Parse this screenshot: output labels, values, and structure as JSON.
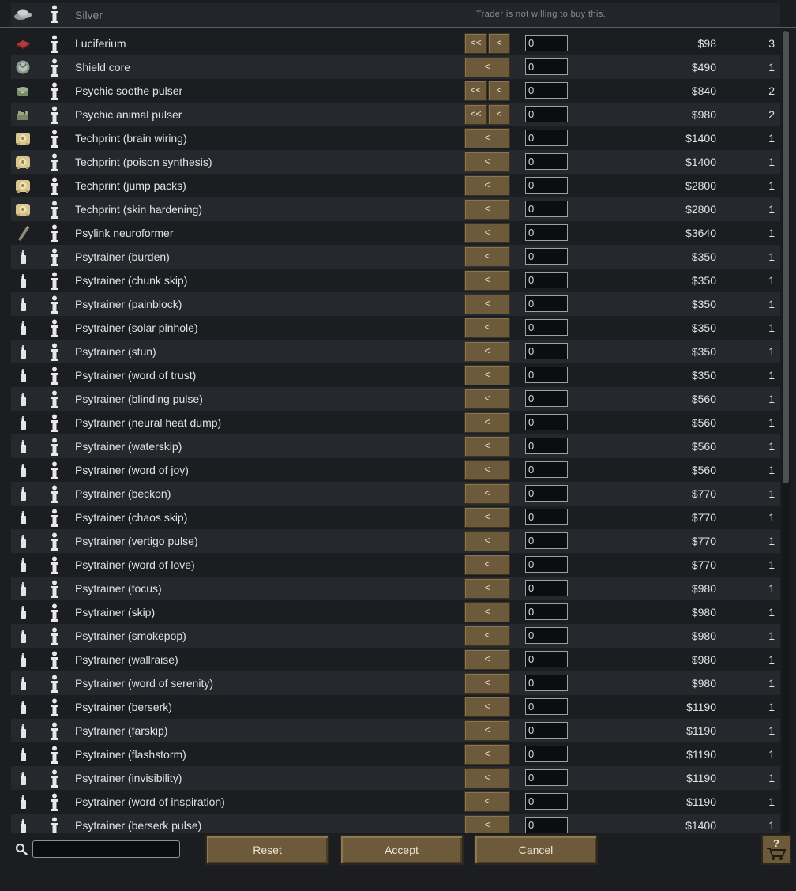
{
  "header": {
    "currency_name": "Silver",
    "note": "Trader is not willing to buy this.",
    "currency_icon": "silver-coins-icon"
  },
  "rows": [
    {
      "name": "Luciferium",
      "price": "$98",
      "count": "3",
      "qty": "0",
      "buttons": [
        "<<",
        "<"
      ],
      "icon": "luciferium-icon"
    },
    {
      "name": "Shield core",
      "price": "$490",
      "count": "1",
      "qty": "0",
      "buttons": [
        "<"
      ],
      "icon": "shield-core-icon"
    },
    {
      "name": "Psychic soothe pulser",
      "price": "$840",
      "count": "2",
      "qty": "0",
      "buttons": [
        "<<",
        "<"
      ],
      "icon": "pulser-icon"
    },
    {
      "name": "Psychic animal pulser",
      "price": "$980",
      "count": "2",
      "qty": "0",
      "buttons": [
        "<<",
        "<"
      ],
      "icon": "animal-pulser-icon"
    },
    {
      "name": "Techprint (brain wiring)",
      "price": "$1400",
      "count": "1",
      "qty": "0",
      "buttons": [
        "<"
      ],
      "icon": "techprint-icon"
    },
    {
      "name": "Techprint (poison synthesis)",
      "price": "$1400",
      "count": "1",
      "qty": "0",
      "buttons": [
        "<"
      ],
      "icon": "techprint-icon"
    },
    {
      "name": "Techprint (jump packs)",
      "price": "$2800",
      "count": "1",
      "qty": "0",
      "buttons": [
        "<"
      ],
      "icon": "techprint-icon"
    },
    {
      "name": "Techprint (skin hardening)",
      "price": "$2800",
      "count": "1",
      "qty": "0",
      "buttons": [
        "<"
      ],
      "icon": "techprint-icon"
    },
    {
      "name": "Psylink neuroformer",
      "price": "$3640",
      "count": "1",
      "qty": "0",
      "buttons": [
        "<"
      ],
      "icon": "neuroformer-icon"
    },
    {
      "name": "Psytrainer (burden)",
      "price": "$350",
      "count": "1",
      "qty": "0",
      "buttons": [
        "<"
      ],
      "icon": "psytrainer-icon"
    },
    {
      "name": "Psytrainer (chunk skip)",
      "price": "$350",
      "count": "1",
      "qty": "0",
      "buttons": [
        "<"
      ],
      "icon": "psytrainer-icon"
    },
    {
      "name": "Psytrainer (painblock)",
      "price": "$350",
      "count": "1",
      "qty": "0",
      "buttons": [
        "<"
      ],
      "icon": "psytrainer-icon"
    },
    {
      "name": "Psytrainer (solar pinhole)",
      "price": "$350",
      "count": "1",
      "qty": "0",
      "buttons": [
        "<"
      ],
      "icon": "psytrainer-icon"
    },
    {
      "name": "Psytrainer (stun)",
      "price": "$350",
      "count": "1",
      "qty": "0",
      "buttons": [
        "<"
      ],
      "icon": "psytrainer-icon"
    },
    {
      "name": "Psytrainer (word of trust)",
      "price": "$350",
      "count": "1",
      "qty": "0",
      "buttons": [
        "<"
      ],
      "icon": "psytrainer-icon"
    },
    {
      "name": "Psytrainer (blinding pulse)",
      "price": "$560",
      "count": "1",
      "qty": "0",
      "buttons": [
        "<"
      ],
      "icon": "psytrainer-icon"
    },
    {
      "name": "Psytrainer (neural heat dump)",
      "price": "$560",
      "count": "1",
      "qty": "0",
      "buttons": [
        "<"
      ],
      "icon": "psytrainer-icon"
    },
    {
      "name": "Psytrainer (waterskip)",
      "price": "$560",
      "count": "1",
      "qty": "0",
      "buttons": [
        "<"
      ],
      "icon": "psytrainer-icon"
    },
    {
      "name": "Psytrainer (word of joy)",
      "price": "$560",
      "count": "1",
      "qty": "0",
      "buttons": [
        "<"
      ],
      "icon": "psytrainer-icon"
    },
    {
      "name": "Psytrainer (beckon)",
      "price": "$770",
      "count": "1",
      "qty": "0",
      "buttons": [
        "<"
      ],
      "icon": "psytrainer-icon"
    },
    {
      "name": "Psytrainer (chaos skip)",
      "price": "$770",
      "count": "1",
      "qty": "0",
      "buttons": [
        "<"
      ],
      "icon": "psytrainer-icon"
    },
    {
      "name": "Psytrainer (vertigo pulse)",
      "price": "$770",
      "count": "1",
      "qty": "0",
      "buttons": [
        "<"
      ],
      "icon": "psytrainer-icon"
    },
    {
      "name": "Psytrainer (word of love)",
      "price": "$770",
      "count": "1",
      "qty": "0",
      "buttons": [
        "<"
      ],
      "icon": "psytrainer-icon"
    },
    {
      "name": "Psytrainer (focus)",
      "price": "$980",
      "count": "1",
      "qty": "0",
      "buttons": [
        "<"
      ],
      "icon": "psytrainer-icon"
    },
    {
      "name": "Psytrainer (skip)",
      "price": "$980",
      "count": "1",
      "qty": "0",
      "buttons": [
        "<"
      ],
      "icon": "psytrainer-icon"
    },
    {
      "name": "Psytrainer (smokepop)",
      "price": "$980",
      "count": "1",
      "qty": "0",
      "buttons": [
        "<"
      ],
      "icon": "psytrainer-icon"
    },
    {
      "name": "Psytrainer (wallraise)",
      "price": "$980",
      "count": "1",
      "qty": "0",
      "buttons": [
        "<"
      ],
      "icon": "psytrainer-icon"
    },
    {
      "name": "Psytrainer (word of serenity)",
      "price": "$980",
      "count": "1",
      "qty": "0",
      "buttons": [
        "<"
      ],
      "icon": "psytrainer-icon"
    },
    {
      "name": "Psytrainer (berserk)",
      "price": "$1190",
      "count": "1",
      "qty": "0",
      "buttons": [
        "<"
      ],
      "icon": "psytrainer-icon"
    },
    {
      "name": "Psytrainer (farskip)",
      "price": "$1190",
      "count": "1",
      "qty": "0",
      "buttons": [
        "<"
      ],
      "icon": "psytrainer-icon"
    },
    {
      "name": "Psytrainer (flashstorm)",
      "price": "$1190",
      "count": "1",
      "qty": "0",
      "buttons": [
        "<"
      ],
      "icon": "psytrainer-icon"
    },
    {
      "name": "Psytrainer (invisibility)",
      "price": "$1190",
      "count": "1",
      "qty": "0",
      "buttons": [
        "<"
      ],
      "icon": "psytrainer-icon"
    },
    {
      "name": "Psytrainer (word of inspiration)",
      "price": "$1190",
      "count": "1",
      "qty": "0",
      "buttons": [
        "<"
      ],
      "icon": "psytrainer-icon"
    },
    {
      "name": "Psytrainer (berserk pulse)",
      "price": "$1400",
      "count": "1",
      "qty": "0",
      "buttons": [
        "<"
      ],
      "icon": "psytrainer-icon"
    }
  ],
  "footer": {
    "search_value": "",
    "reset_label": "Reset",
    "accept_label": "Accept",
    "cancel_label": "Cancel",
    "cart_icon": "trade-cart-help-icon"
  },
  "colors": {
    "background": "#1b1d21",
    "row_alt": "#25282d",
    "button": "#6c5a3a",
    "text": "#e2e2e2"
  }
}
